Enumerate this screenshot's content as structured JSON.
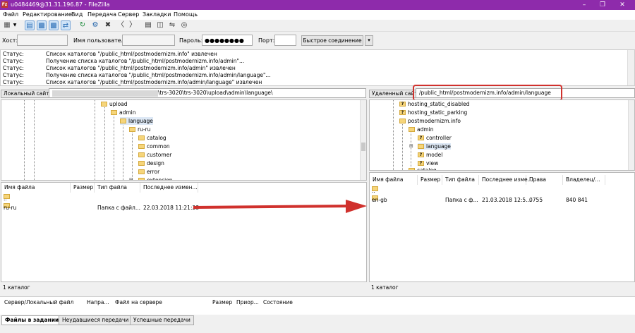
{
  "window": {
    "title": "u0484469@31.31.196.87 - FileZilla",
    "app_icon": "filezilla-icon",
    "controls": [
      "minimize",
      "maximize",
      "close"
    ]
  },
  "menu": [
    "Файл",
    "Редактирование",
    "Вид",
    "Передача",
    "Сервер",
    "Закладки",
    "Помощь"
  ],
  "toolbar": {
    "icons": [
      "site-manager-icon",
      "dropdown-arrow-icon",
      "message-log-toggle-icon",
      "local-tree-toggle-icon",
      "remote-tree-toggle-icon",
      "transfer-queue-toggle-icon",
      "refresh-icon",
      "process-queue-icon",
      "cancel-icon",
      "disconnect-icon",
      "reconnect-icon",
      "filter-icon",
      "compare-icon",
      "sync-browse-icon",
      "search-icon"
    ]
  },
  "quickconnect": {
    "host_label": "Хост:",
    "host_value": "",
    "user_label": "Имя пользователя",
    "user_value": "",
    "pass_label": "Пароль:",
    "pass_value": "●●●●●●●●",
    "port_label": "Порт:",
    "port_value": "",
    "button": "Быстрое соединение",
    "dropdown": "▾"
  },
  "log": [
    {
      "k": "Статус:",
      "v": "Список каталогов \"/public_html/postmodernizm.info\" извлечен"
    },
    {
      "k": "Статус:",
      "v": "Получение списка каталогов \"/public_html/postmodernizm.info/admin\"..."
    },
    {
      "k": "Статус:",
      "v": "Список каталогов \"/public_html/postmodernizm.info/admin\" извлечен"
    },
    {
      "k": "Статус:",
      "v": "Получение списка каталогов \"/public_html/postmodernizm.info/admin/language\"..."
    },
    {
      "k": "Статус:",
      "v": "Список каталогов \"/public_html/postmodernizm.info/admin/language\" извлечен"
    }
  ],
  "local": {
    "label": "Локальный сайт:",
    "path": "\\trs-3020\\trs-3020\\upload\\admin\\language\\",
    "tree": [
      "upload",
      "admin",
      "language",
      "ru-ru",
      "catalog",
      "common",
      "customer",
      "design",
      "error",
      "extension"
    ],
    "columns": [
      "Имя файла",
      "Размер",
      "Тип файла",
      "Последнее измен..."
    ],
    "files": [
      {
        "name": "..",
        "size": "",
        "type": "",
        "modified": ""
      },
      {
        "name": "ru-ru",
        "size": "",
        "type": "Папка с файл...",
        "modified": "22.03.2018 11:21:28"
      }
    ],
    "status": "1 каталог"
  },
  "remote": {
    "label": "Удаленный сайт:",
    "path": "/public_html/postmodernizm.info/admin/language",
    "tree": [
      "hosting_static_disabled",
      "hosting_static_parking",
      "postmodernizm.info",
      "admin",
      "controller",
      "language",
      "model",
      "view",
      "catalog"
    ],
    "columns": [
      "Имя файла",
      "Размер",
      "Тип файла",
      "Последнее изме...",
      "Права",
      "Владелец/..."
    ],
    "files": [
      {
        "name": "..",
        "size": "",
        "type": "",
        "modified": "",
        "perms": "",
        "owner": ""
      },
      {
        "name": "en-gb",
        "size": "",
        "type": "Папка с ф...",
        "modified": "21.03.2018 12:5...",
        "perms": "0755",
        "owner": "840 841"
      }
    ],
    "status": "1 каталог"
  },
  "queue": {
    "columns": [
      "Сервер/Локальный файл",
      "Напра...",
      "Файл на сервере",
      "Размер",
      "Приор...",
      "Состояние"
    ]
  },
  "tabs": [
    "Файлы в задании",
    "Неудавшиеся передачи",
    "Успешные передачи"
  ],
  "annotation": {
    "arrow_color": "#d0312d",
    "box_color": "#d0312d"
  }
}
